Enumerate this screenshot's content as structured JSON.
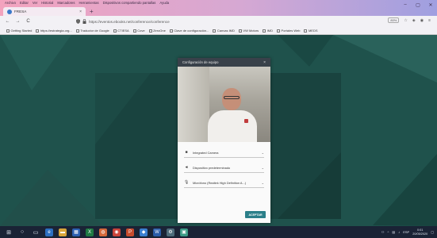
{
  "menu": [
    "Archivo",
    "Editar",
    "Ver",
    "Historial",
    "Marcadores",
    "Herramientas",
    "Dispositivos compartiendo pantallas",
    "Ayuda"
  ],
  "tab": {
    "title": "FRESA",
    "close": "×"
  },
  "new_tab": "+",
  "window_controls": [
    "–",
    "▢",
    "✕"
  ],
  "toolbar": {
    "back": "←",
    "forward": "→",
    "reload": "C",
    "url": "https://eventos.ebooks.net/conference/conference",
    "zoom": "80%"
  },
  "bookmarks": [
    "Getting Started",
    "https://estrategia.org...",
    "Traductor de Google",
    "CTIESA",
    "Cove",
    "ZeroOne",
    "Clave de configuración...",
    "Canvas IMD",
    "VW Motors",
    "IMD",
    "Portales Web",
    "MEDS"
  ],
  "dialog": {
    "title": "Configuración de equipo",
    "close": "×",
    "devices": [
      {
        "icon": "camera-icon",
        "label": "Integrated Camera"
      },
      {
        "icon": "speaker-icon",
        "label": "Dispositivo predeterminado"
      },
      {
        "icon": "microphone-icon",
        "label": "Micrófono (Realtek High Definition A...)"
      }
    ],
    "chevron": "⌄",
    "accept": "ACEPTAR"
  },
  "taskbar": {
    "language": "ESP",
    "time": "0:01",
    "date": "20/05/2020"
  },
  "colors": {
    "page_bg": "#1f524c",
    "panel_bg": "#19433f",
    "dialog_header": "#39414a",
    "accept_button": "#2b7f89",
    "taskbar": "#1a2335"
  }
}
